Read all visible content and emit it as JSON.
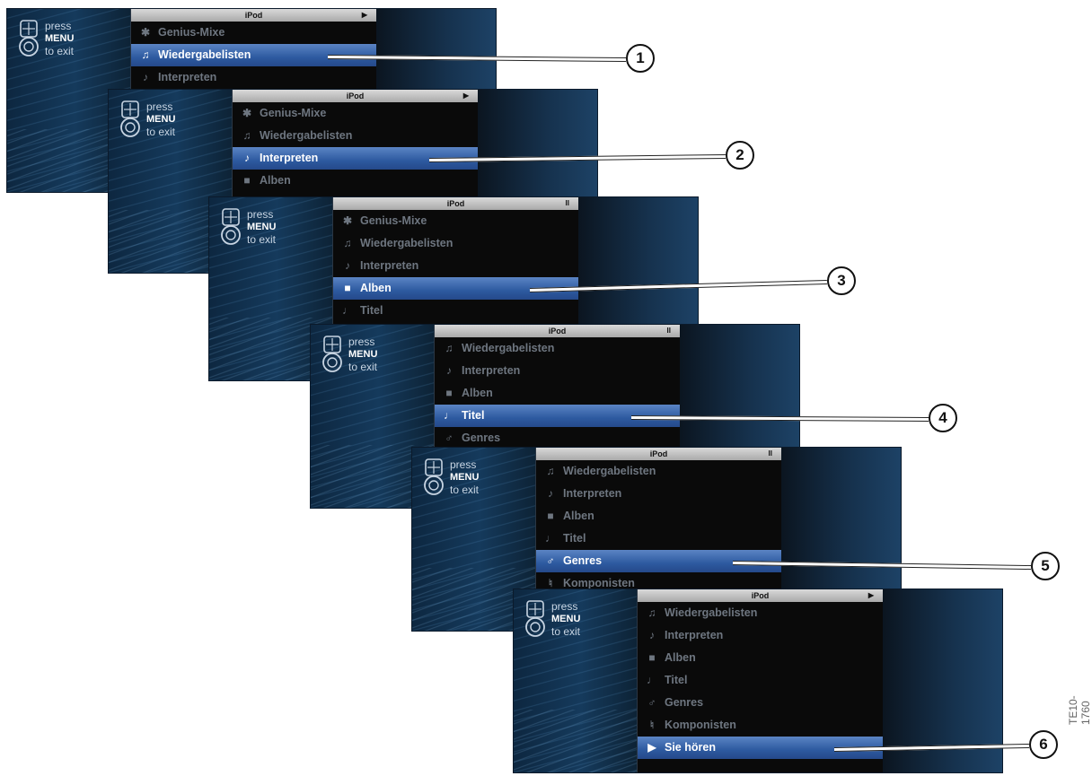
{
  "hint": {
    "press": "press",
    "menu": "MENU",
    "exit": "to exit"
  },
  "screens": [
    {
      "title": "iPod",
      "status": "▶",
      "items": [
        {
          "icon": "genius-icon",
          "glyph": "✱",
          "label": "Genius-Mixe",
          "selected": false
        },
        {
          "icon": "playlist-icon",
          "glyph": "♫",
          "label": "Wiedergabelisten",
          "selected": true
        },
        {
          "icon": "artist-icon",
          "glyph": "♪",
          "label": "Interpreten",
          "selected": false
        }
      ],
      "callout": "1"
    },
    {
      "title": "iPod",
      "status": "▶",
      "items": [
        {
          "icon": "genius-icon",
          "glyph": "✱",
          "label": "Genius-Mixe",
          "selected": false
        },
        {
          "icon": "playlist-icon",
          "glyph": "♫",
          "label": "Wiedergabelisten",
          "selected": false
        },
        {
          "icon": "artist-icon",
          "glyph": "♪",
          "label": "Interpreten",
          "selected": true
        },
        {
          "icon": "album-icon",
          "glyph": "■",
          "label": "Alben",
          "selected": false
        }
      ],
      "callout": "2"
    },
    {
      "title": "iPod",
      "status": "II",
      "items": [
        {
          "icon": "genius-icon",
          "glyph": "✱",
          "label": "Genius-Mixe",
          "selected": false
        },
        {
          "icon": "playlist-icon",
          "glyph": "♫",
          "label": "Wiedergabelisten",
          "selected": false
        },
        {
          "icon": "artist-icon",
          "glyph": "♪",
          "label": "Interpreten",
          "selected": false
        },
        {
          "icon": "album-icon",
          "glyph": "■",
          "label": "Alben",
          "selected": true
        },
        {
          "icon": "title-icon",
          "glyph": "♩",
          "label": "Titel",
          "selected": false
        }
      ],
      "callout": "3"
    },
    {
      "title": "iPod",
      "status": "II",
      "items": [
        {
          "icon": "playlist-icon",
          "glyph": "♫",
          "label": "Wiedergabelisten",
          "selected": false
        },
        {
          "icon": "artist-icon",
          "glyph": "♪",
          "label": "Interpreten",
          "selected": false
        },
        {
          "icon": "album-icon",
          "glyph": "■",
          "label": "Alben",
          "selected": false
        },
        {
          "icon": "title-icon",
          "glyph": "♩",
          "label": "Titel",
          "selected": true
        },
        {
          "icon": "genre-icon",
          "glyph": "♂",
          "label": "Genres",
          "selected": false
        }
      ],
      "callout": "4"
    },
    {
      "title": "iPod",
      "status": "II",
      "items": [
        {
          "icon": "playlist-icon",
          "glyph": "♫",
          "label": "Wiedergabelisten",
          "selected": false
        },
        {
          "icon": "artist-icon",
          "glyph": "♪",
          "label": "Interpreten",
          "selected": false
        },
        {
          "icon": "album-icon",
          "glyph": "■",
          "label": "Alben",
          "selected": false
        },
        {
          "icon": "title-icon",
          "glyph": "♩",
          "label": "Titel",
          "selected": false
        },
        {
          "icon": "genre-icon",
          "glyph": "♂",
          "label": "Genres",
          "selected": true
        },
        {
          "icon": "composer-icon",
          "glyph": "♮",
          "label": "Komponisten",
          "selected": false
        }
      ],
      "callout": "5"
    },
    {
      "title": "iPod",
      "status": "▶",
      "items": [
        {
          "icon": "playlist-icon",
          "glyph": "♫",
          "label": "Wiedergabelisten",
          "selected": false
        },
        {
          "icon": "artist-icon",
          "glyph": "♪",
          "label": "Interpreten",
          "selected": false
        },
        {
          "icon": "album-icon",
          "glyph": "■",
          "label": "Alben",
          "selected": false
        },
        {
          "icon": "title-icon",
          "glyph": "♩",
          "label": "Titel",
          "selected": false
        },
        {
          "icon": "genre-icon",
          "glyph": "♂",
          "label": "Genres",
          "selected": false
        },
        {
          "icon": "composer-icon",
          "glyph": "♮",
          "label": "Komponisten",
          "selected": false
        },
        {
          "icon": "now-playing-icon",
          "glyph": "▶",
          "label": "Sie hören",
          "selected": true
        }
      ],
      "callout": "6"
    }
  ],
  "figure_id": "TE10-1760",
  "colors": {
    "selection": "#2d5aa0",
    "text_dim": "#6e7680"
  }
}
